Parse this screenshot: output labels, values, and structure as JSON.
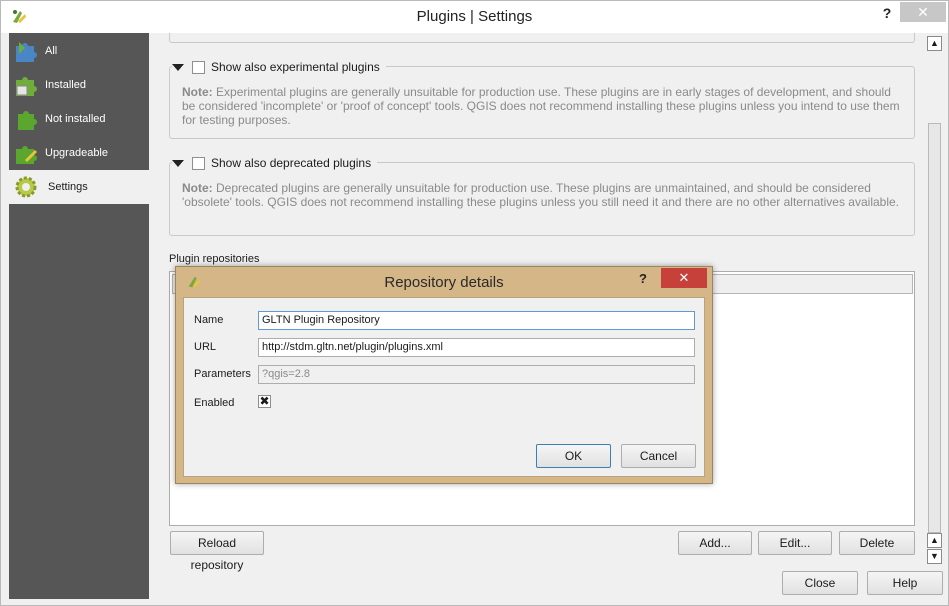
{
  "window": {
    "title": "Plugins | Settings",
    "help_glyph": "?",
    "close_glyph": "✕"
  },
  "sidebar": {
    "items": [
      {
        "label": "All",
        "icon": "puzzle-all-icon"
      },
      {
        "label": "Installed",
        "icon": "puzzle-installed-icon"
      },
      {
        "label": "Not installed",
        "icon": "puzzle-not-installed-icon"
      },
      {
        "label": "Upgradeable",
        "icon": "puzzle-upgradeable-icon"
      },
      {
        "label": "Settings",
        "icon": "gear-icon"
      }
    ],
    "active": "Settings",
    "bg_color": "#565656"
  },
  "settings": {
    "experimental": {
      "label": "Show also experimental plugins",
      "checked": false,
      "note_prefix": "Note:",
      "note": "Experimental plugins are generally unsuitable for production use. These plugins are in early stages of development, and should be considered 'incomplete' or 'proof of concept' tools. QGIS does not recommend installing these plugins unless you intend to use them for testing purposes."
    },
    "deprecated": {
      "label": "Show also deprecated plugins",
      "checked": false,
      "note_prefix": "Note:",
      "note": "Deprecated plugins are generally unsuitable for production use. These plugins are unmaintained, and should be considered 'obsolete' tools. QGIS does not recommend installing these plugins unless you still need it and there are no other alternatives available."
    },
    "repositories": {
      "label": "Plugin repositories",
      "reload_label": "Reload repository",
      "add_label": "Add...",
      "edit_label": "Edit...",
      "delete_label": "Delete"
    }
  },
  "footer": {
    "close_label": "Close",
    "help_label": "Help"
  },
  "dialog": {
    "title": "Repository details",
    "help_glyph": "?",
    "close_glyph": "✕",
    "name_label": "Name",
    "name_value": "GLTN Plugin Repository",
    "url_label": "URL",
    "url_value": "http://stdm.gltn.net/plugin/plugins.xml",
    "params_label": "Parameters",
    "params_placeholder": "?qgis=2.8",
    "enabled_label": "Enabled",
    "enabled_checked": true,
    "enabled_mark": "✖",
    "ok_label": "OK",
    "cancel_label": "Cancel",
    "accent_color": "#d4b687",
    "close_color": "#c7413b"
  }
}
